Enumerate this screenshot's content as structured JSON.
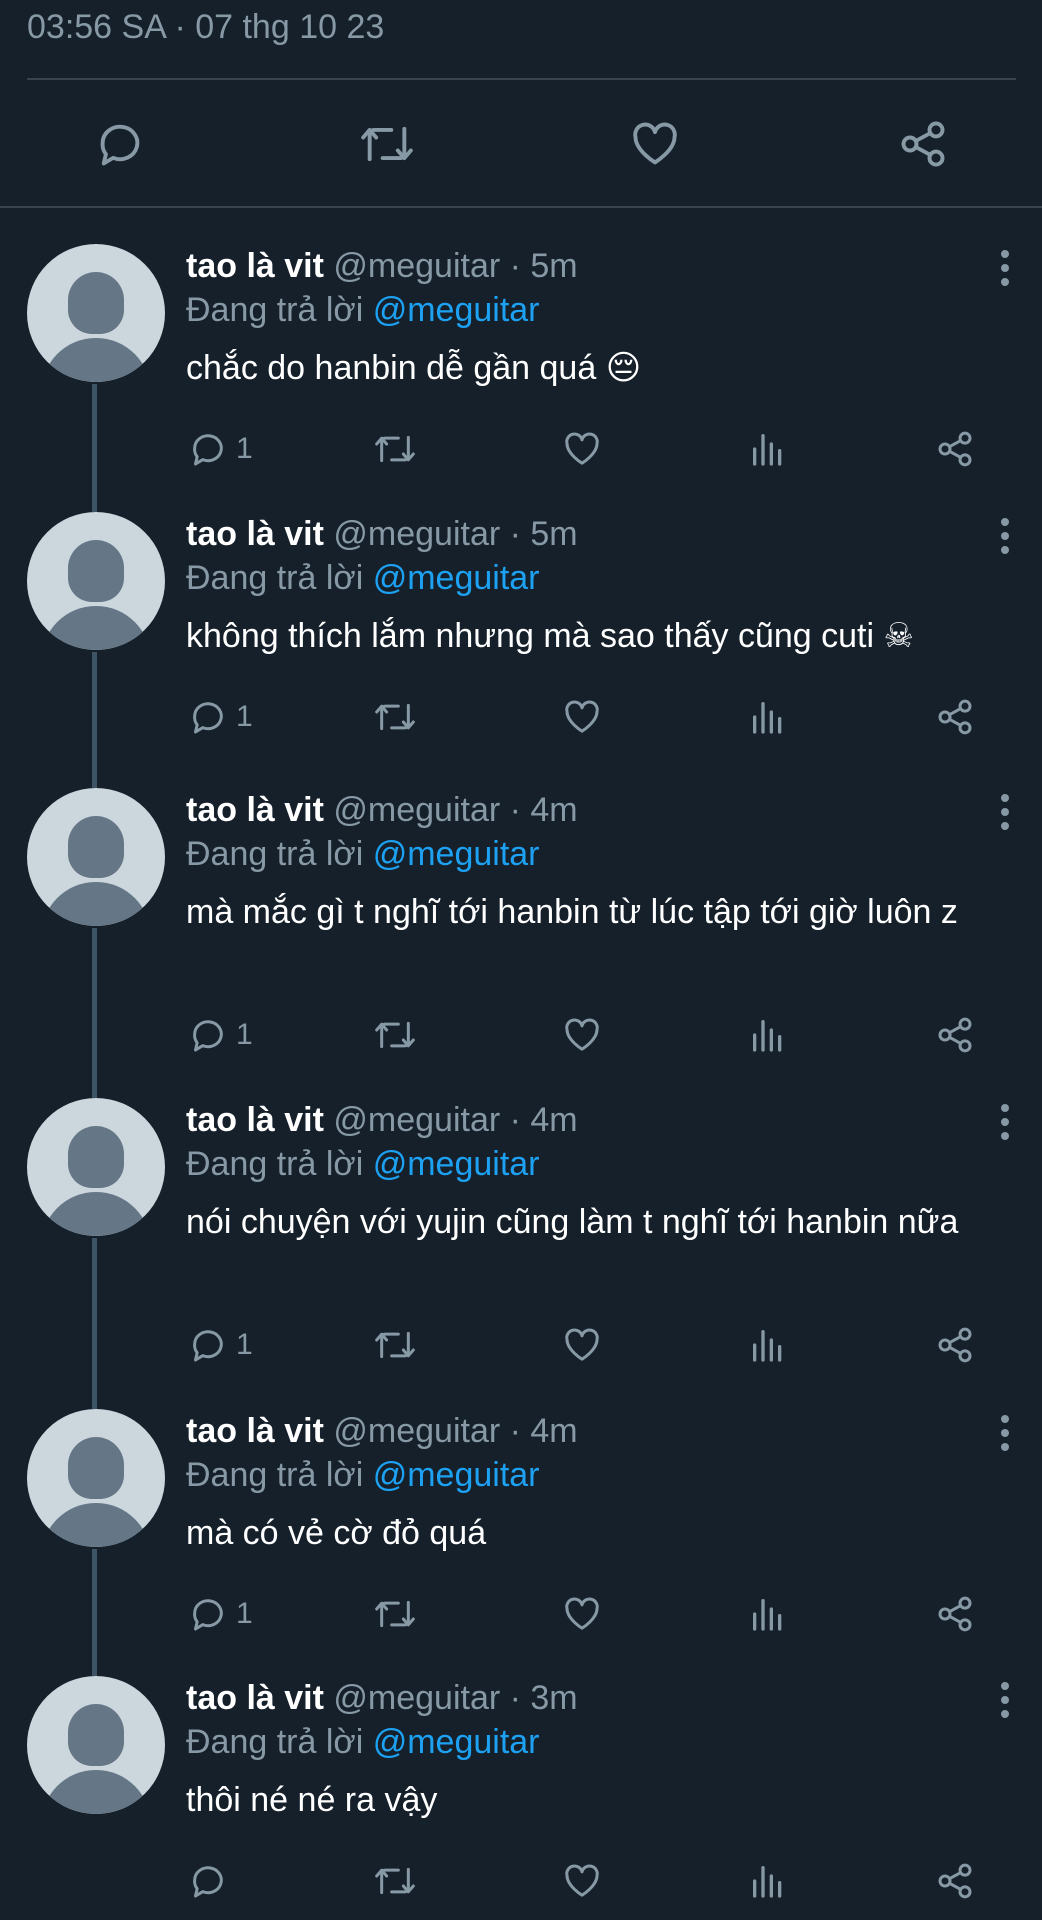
{
  "timestamp": "03:56 SA · 07 thg 10 23",
  "main_actions": {
    "reply_icon": "reply-icon",
    "retweet_icon": "retweet-icon",
    "like_icon": "heart-icon",
    "share_icon": "share-icon"
  },
  "colors": {
    "background": "#15202b",
    "secondary_text": "#8899a6",
    "link": "#1da1f2",
    "divider": "#38444d"
  },
  "tweets": [
    {
      "name": "tao là vit",
      "handle": "@meguitar · 5m",
      "reply_prefix": "Đang trả lời ",
      "reply_mention": "@meguitar",
      "text": "chắc do hanbin dễ gần quá 😔",
      "reply_count": "1"
    },
    {
      "name": "tao là vit",
      "handle": "@meguitar · 5m",
      "reply_prefix": "Đang trả lời ",
      "reply_mention": "@meguitar",
      "text": "không thích lắm nhưng mà sao thấy cũng cuti ☠",
      "reply_count": "1"
    },
    {
      "name": "tao là vit",
      "handle": "@meguitar · 4m",
      "reply_prefix": "Đang trả lời ",
      "reply_mention": "@meguitar",
      "text": "mà mắc gì t nghĩ tới hanbin từ lúc tập tới giờ luôn z",
      "reply_count": "1"
    },
    {
      "name": "tao là vit",
      "handle": "@meguitar · 4m",
      "reply_prefix": "Đang trả lời ",
      "reply_mention": "@meguitar",
      "text": "nói chuyện với yujin cũng làm t nghĩ tới hanbin nữa",
      "reply_count": "1"
    },
    {
      "name": "tao là vit",
      "handle": "@meguitar · 4m",
      "reply_prefix": "Đang trả lời ",
      "reply_mention": "@meguitar",
      "text": "mà có vẻ cờ đỏ quá",
      "reply_count": "1"
    },
    {
      "name": "tao là vit",
      "handle": "@meguitar · 3m",
      "reply_prefix": "Đang trả lời ",
      "reply_mention": "@meguitar",
      "text": "thôi né né ra vậy",
      "reply_count": ""
    }
  ]
}
